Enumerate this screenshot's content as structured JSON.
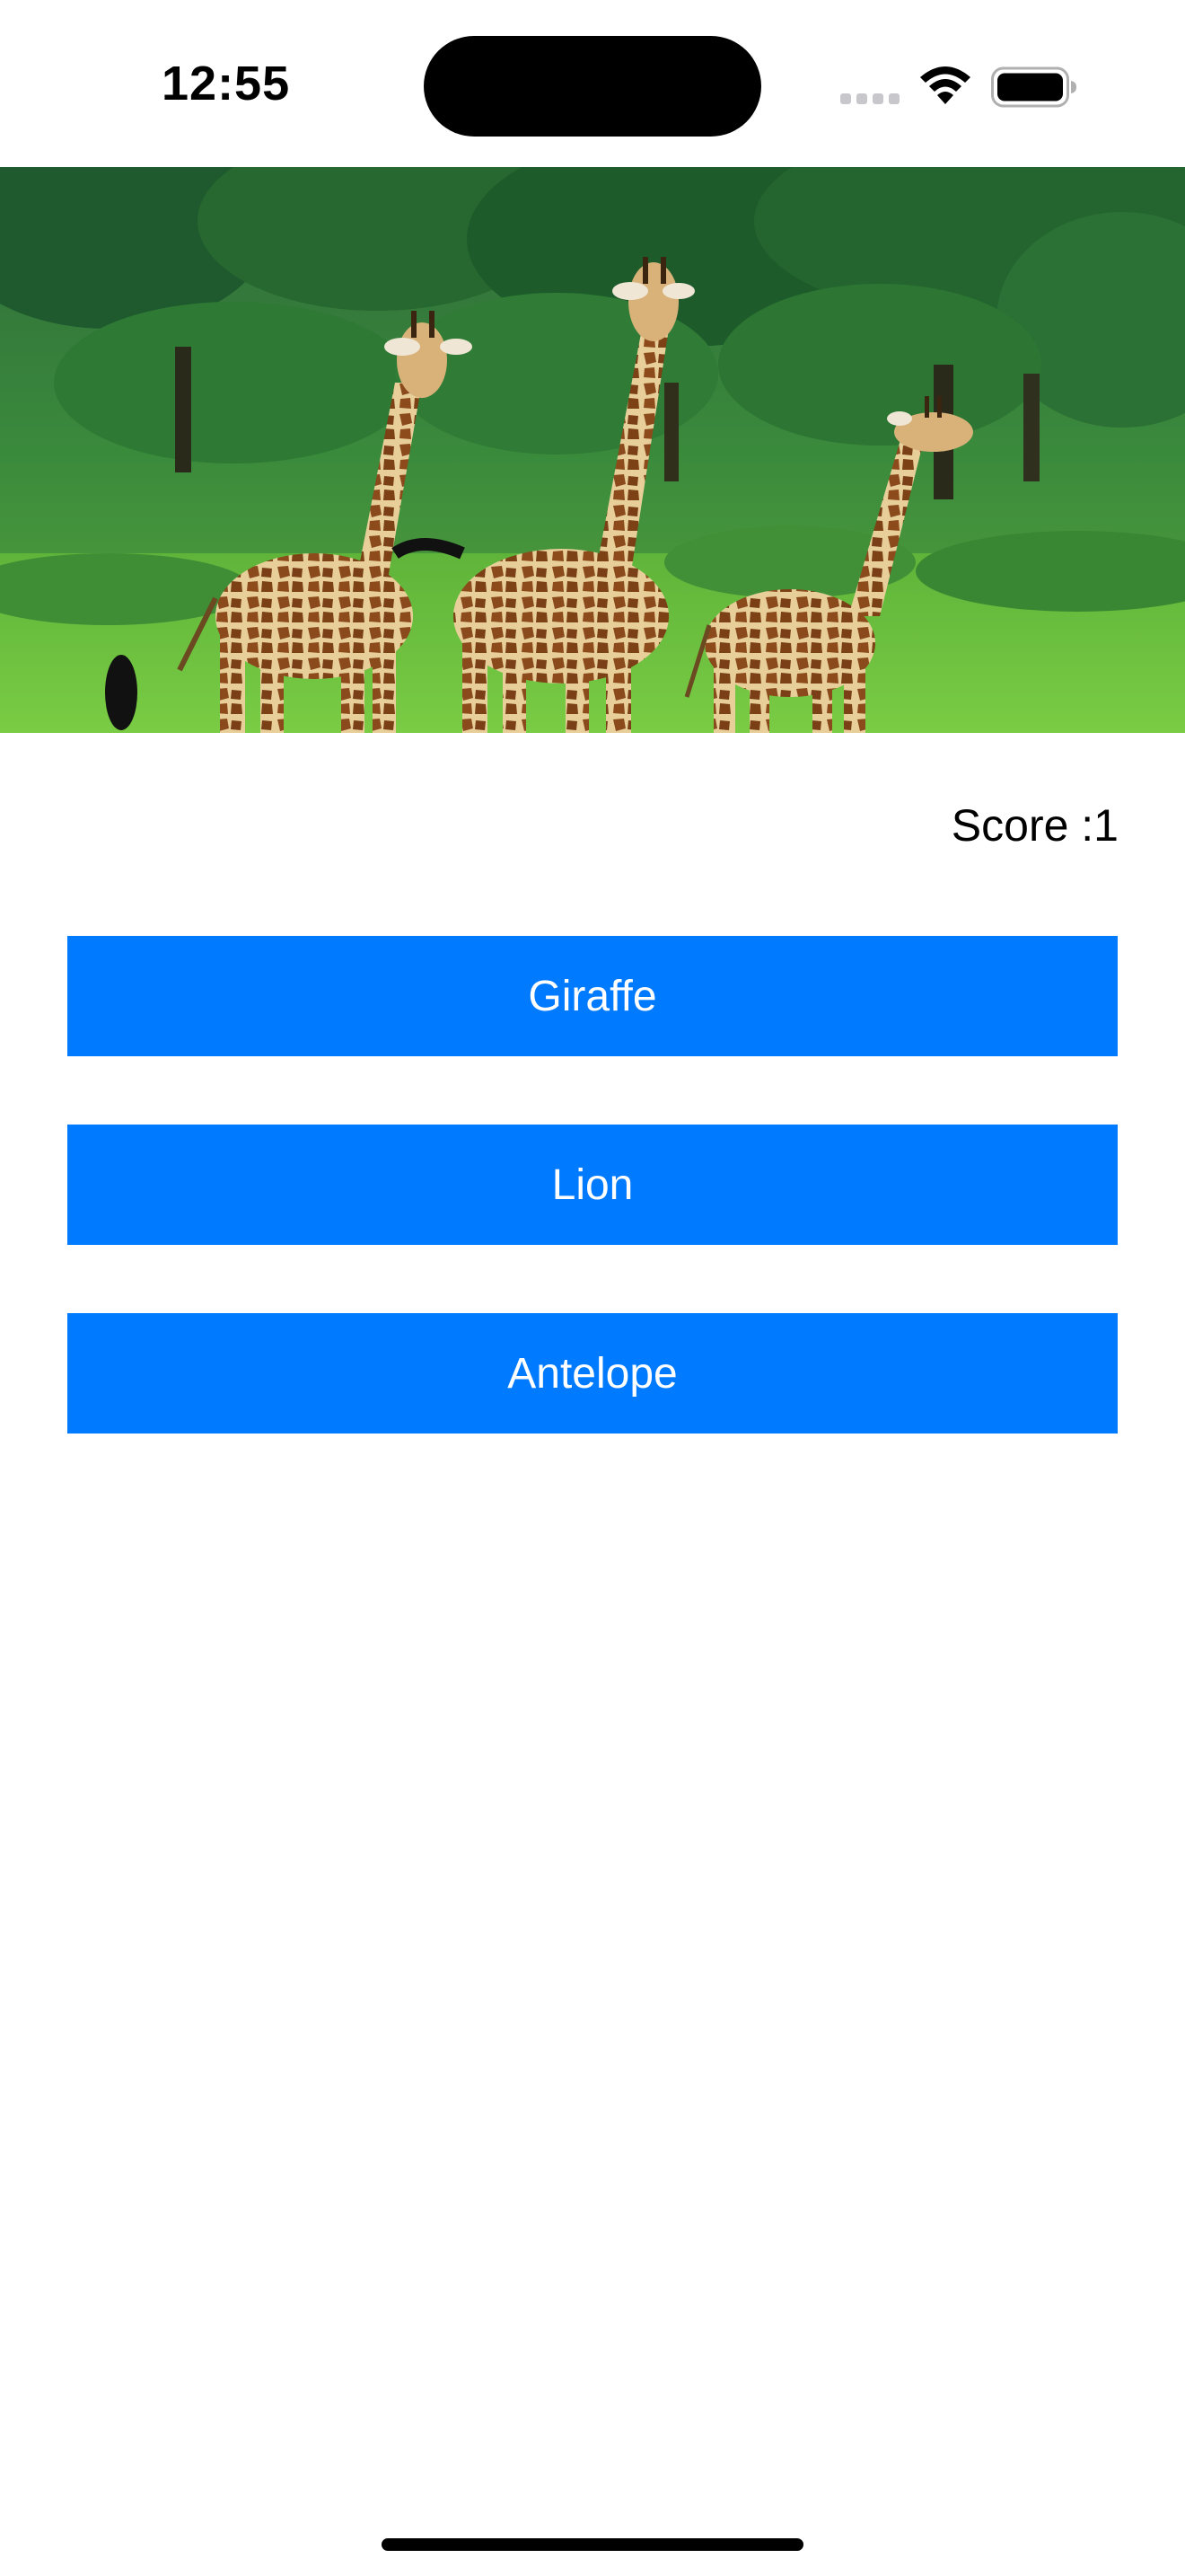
{
  "status_bar": {
    "time": "12:55",
    "icons": [
      "cellular-signal-icon",
      "wifi-icon",
      "battery-icon"
    ]
  },
  "hero_image": {
    "subject": "giraffes-in-savanna"
  },
  "score": {
    "text": "Score :1"
  },
  "answers": [
    {
      "label": "Giraffe"
    },
    {
      "label": "Lion"
    },
    {
      "label": "Antelope"
    }
  ],
  "colors": {
    "button_background": "#007aff",
    "button_text": "#ffffff",
    "page_background": "#ffffff"
  }
}
